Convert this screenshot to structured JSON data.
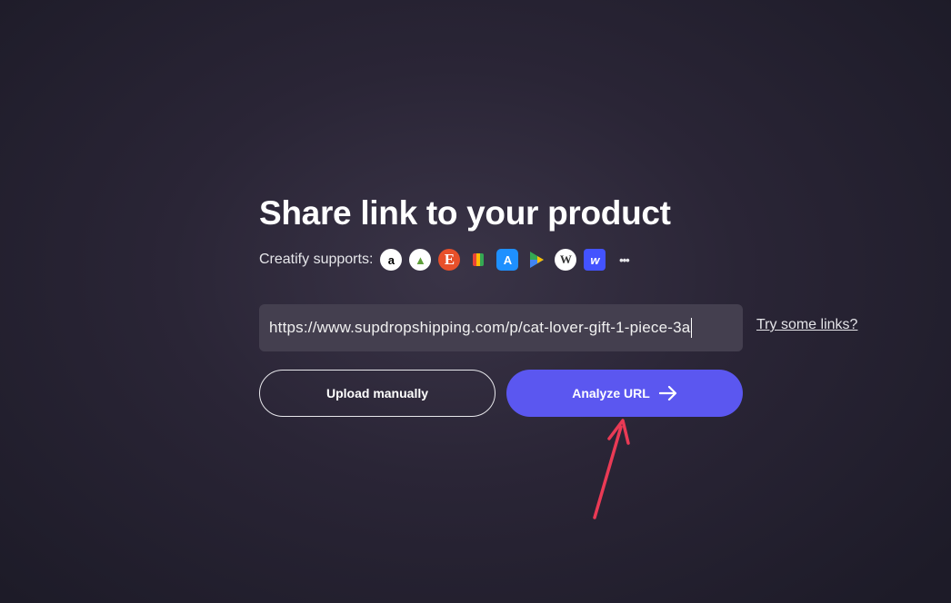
{
  "title": "Share link to your product",
  "supports": {
    "label": "Creatify supports:",
    "icons": [
      "amazon-icon",
      "shopify-icon",
      "etsy-icon",
      "google-shopping-icon",
      "app-store-icon",
      "google-play-icon",
      "wordpress-icon",
      "webflow-icon",
      "more-icon"
    ]
  },
  "url_input": {
    "value": "https://www.supdropshipping.com/p/cat-lover-gift-1-piece-3a"
  },
  "try_link": "Try some links?",
  "buttons": {
    "upload": "Upload manually",
    "analyze": "Analyze URL"
  },
  "colors": {
    "accent": "#5b57f0",
    "arrow": "#ea3a55"
  }
}
